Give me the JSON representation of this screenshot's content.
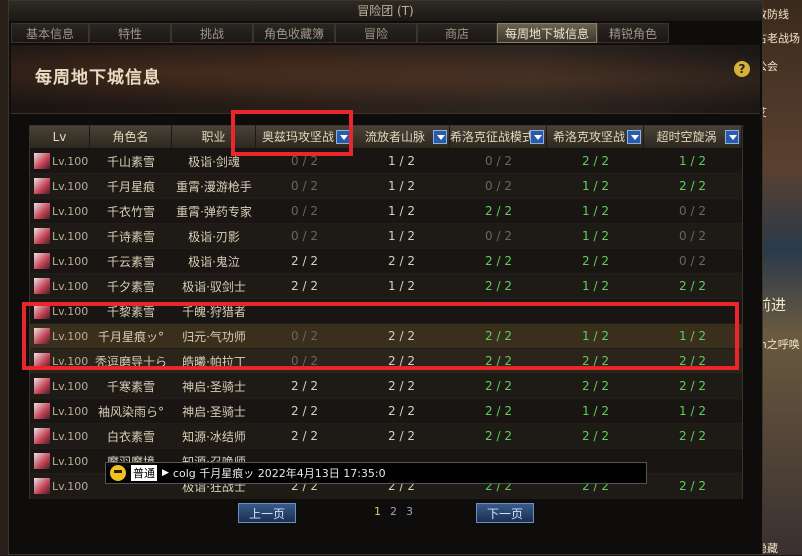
{
  "window": {
    "title": "冒险团 (T)"
  },
  "tabs": [
    {
      "label": "基本信息",
      "active": false
    },
    {
      "label": "特性",
      "active": false
    },
    {
      "label": "挑战",
      "active": false
    },
    {
      "label": "角色收藏簿",
      "active": false
    },
    {
      "label": "冒险",
      "active": false
    },
    {
      "label": "商店",
      "active": false
    },
    {
      "label": "每周地下城信息",
      "active": true
    },
    {
      "label": "精锐角色",
      "active": false
    }
  ],
  "banner": {
    "title": "每周地下城信息",
    "help": "?"
  },
  "right_overlay": [
    "改防线",
    "古老战场",
    "公会",
    "艾",
    "前进",
    "m之呼唤",
    "隐藏"
  ],
  "table": {
    "headers": [
      "Lv",
      "角色名",
      "职业",
      "奥兹玛攻坚战",
      "流放者山脉",
      "希洛克征战模式",
      "希洛克攻坚战",
      "超时空旋涡"
    ],
    "rows": [
      {
        "lv": "Lv.100",
        "name": "千山素雪",
        "job": "极诣·剑魂",
        "d": [
          "0 / 2",
          "1 / 2",
          "0 / 2",
          "2 / 2",
          "1 / 2"
        ]
      },
      {
        "lv": "Lv.100",
        "name": "千月星痕",
        "job": "重霄·漫游枪手",
        "d": [
          "0 / 2",
          "1 / 2",
          "0 / 2",
          "1 / 2",
          "2 / 2"
        ]
      },
      {
        "lv": "Lv.100",
        "name": "千衣竹雪",
        "job": "重霄·弹药专家",
        "d": [
          "0 / 2",
          "1 / 2",
          "2 / 2",
          "1 / 2",
          "0 / 2"
        ]
      },
      {
        "lv": "Lv.100",
        "name": "千诗素雪",
        "job": "极诣·刃影",
        "d": [
          "0 / 2",
          "1 / 2",
          "0 / 2",
          "1 / 2",
          "0 / 2"
        ]
      },
      {
        "lv": "Lv.100",
        "name": "千云素雪",
        "job": "极诣·鬼泣",
        "d": [
          "2 / 2",
          "2 / 2",
          "2 / 2",
          "2 / 2",
          "0 / 2"
        ]
      },
      {
        "lv": "Lv.100",
        "name": "千夕素雪",
        "job": "极诣·驭剑士",
        "d": [
          "2 / 2",
          "1 / 2",
          "2 / 2",
          "1 / 2",
          "2 / 2"
        ]
      },
      {
        "lv": "Lv.100",
        "name": "千黎素雪",
        "job": "千魄·狩猎者",
        "d": [
          "",
          "",
          "",
          "",
          ""
        ]
      },
      {
        "lv": "Lv.100",
        "name": "千月星痕ッ°",
        "job": "归元·气功师",
        "d": [
          "0 / 2",
          "2 / 2",
          "2 / 2",
          "1 / 2",
          "1 / 2"
        ]
      },
      {
        "lv": "Lv.100",
        "name": "秃逗磨导十ら",
        "job": "皓曦·帕拉丁",
        "d": [
          "0 / 2",
          "2 / 2",
          "2 / 2",
          "2 / 2",
          "2 / 2"
        ]
      },
      {
        "lv": "Lv.100",
        "name": "千寒素雪",
        "job": "神启·圣骑士",
        "d": [
          "2 / 2",
          "2 / 2",
          "2 / 2",
          "2 / 2",
          "2 / 2"
        ]
      },
      {
        "lv": "Lv.100",
        "name": "袖风染雨ら°",
        "job": "神启·圣骑士",
        "d": [
          "2 / 2",
          "2 / 2",
          "2 / 2",
          "1 / 2",
          "1 / 2"
        ]
      },
      {
        "lv": "Lv.100",
        "name": "白衣素雪",
        "job": "知源·冰结师",
        "d": [
          "2 / 2",
          "2 / 2",
          "2 / 2",
          "2 / 2",
          "2 / 2"
        ]
      },
      {
        "lv": "Lv.100",
        "name": "魔羽魔境",
        "job": "知源·召唤师",
        "d": [
          "",
          "",
          "",
          "",
          ""
        ]
      },
      {
        "lv": "Lv.100",
        "name": "",
        "job": "极诣·狂战士",
        "d": [
          "2 / 2",
          "2 / 2",
          "2 / 2",
          "2 / 2",
          "2 / 2"
        ]
      }
    ]
  },
  "pager": {
    "prev": "上一页",
    "next": "下一页",
    "pages": [
      "1",
      "2",
      "3"
    ],
    "current": "1"
  },
  "chat": {
    "tag": "普通",
    "text": "colg 千月星痕ッ 2022年4月13日 17:35:0"
  }
}
